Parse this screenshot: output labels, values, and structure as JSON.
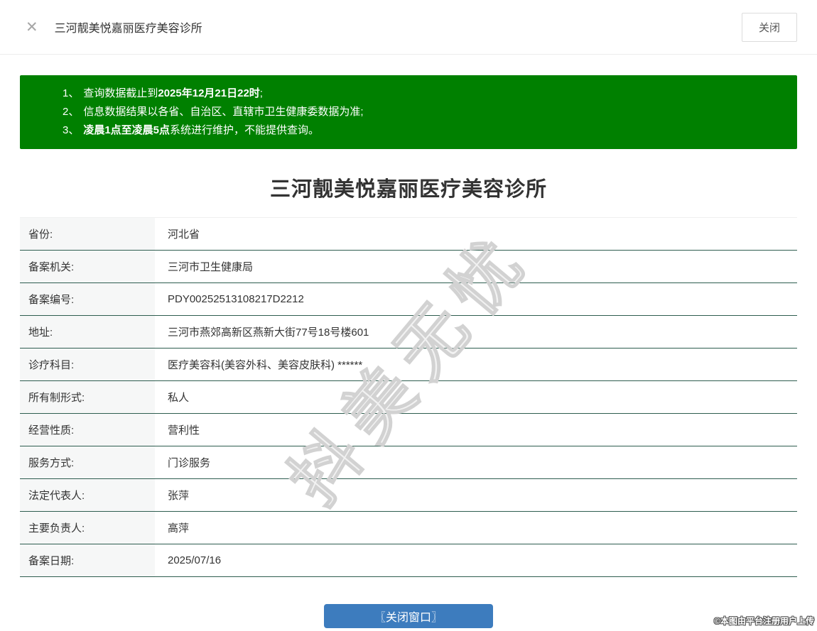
{
  "header": {
    "close_icon": "✕",
    "title": "三河靓美悦嘉丽医疗美容诊所",
    "close_button_label": "关闭"
  },
  "notice": {
    "items": [
      {
        "num": "1、",
        "segments": [
          {
            "text": "查询数据截止到",
            "bold": false
          },
          {
            "text": "2025年12月21日22时",
            "bold": true
          },
          {
            "text": ";",
            "bold": false
          }
        ]
      },
      {
        "num": "2、",
        "segments": [
          {
            "text": "信息数据结果以各省、自治区、直辖市卫生健康委数据为准;",
            "bold": false
          }
        ]
      },
      {
        "num": "3、",
        "segments": [
          {
            "text": "凌晨1点至凌晨5点",
            "bold": true
          },
          {
            "text": "系统进行维护，不能提供查询。",
            "bold": false
          }
        ]
      }
    ]
  },
  "record": {
    "title": "三河靓美悦嘉丽医疗美容诊所",
    "fields": [
      {
        "label": "省份:",
        "value": "河北省"
      },
      {
        "label": "备案机关:",
        "value": "三河市卫生健康局"
      },
      {
        "label": "备案编号:",
        "value": "PDY00252513108217D2212"
      },
      {
        "label": "地址:",
        "value": "三河市燕郊高新区燕新大街77号18号楼601"
      },
      {
        "label": "诊疗科目:",
        "value": "医疗美容科(美容外科、美容皮肤科) ******"
      },
      {
        "label": "所有制形式:",
        "value": "私人"
      },
      {
        "label": "经营性质:",
        "value": "营利性"
      },
      {
        "label": "服务方式:",
        "value": "门诊服务"
      },
      {
        "label": "法定代表人:",
        "value": "张萍"
      },
      {
        "label": "主要负责人:",
        "value": "高萍"
      },
      {
        "label": "备案日期:",
        "value": "2025/07/16"
      }
    ]
  },
  "watermark": {
    "text": "抖美无忧"
  },
  "footer": {
    "close_window_button": "〖关闭窗口〗",
    "attribution": "©本图由平台注册用户上传"
  },
  "colors": {
    "notice_green": "#008000",
    "divider_green": "#2e5d4f",
    "button_blue": "#3d7cbe"
  }
}
